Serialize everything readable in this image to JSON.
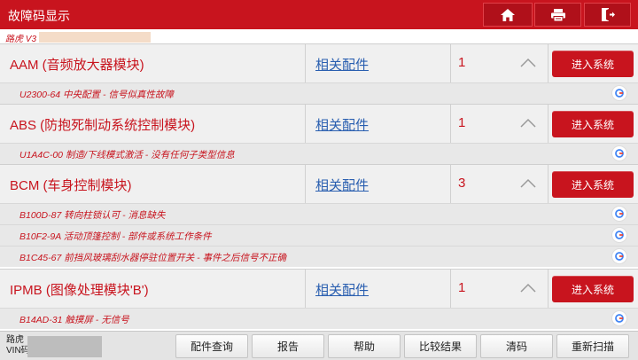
{
  "header": {
    "title": "故障码显示",
    "buttons": [
      "home-icon",
      "print-icon",
      "exit-icon"
    ]
  },
  "vehicle_label": "路虎 V3",
  "systems": [
    {
      "name": "AAM (音频放大器模块)",
      "parts_link": "相关配件",
      "count": "1",
      "enter": "进入系统",
      "dtcs": [
        "U2300-64 中央配置 - 信号似真性故障"
      ]
    },
    {
      "name": "ABS (防抱死制动系统控制模块)",
      "parts_link": "相关配件",
      "count": "1",
      "enter": "进入系统",
      "dtcs": [
        "U1A4C-00 制造/下线模式激活 - 没有任何子类型信息"
      ]
    },
    {
      "name": "BCM (车身控制模块)",
      "parts_link": "相关配件",
      "count": "3",
      "enter": "进入系统",
      "dtcs": [
        "B100D-87 转向柱锁认可 - 消息缺失",
        "B10F2-9A 活动顶篷控制 - 部件或系统工作条件",
        "B1C45-67 前挡风玻璃刮水器停驻位置开关 - 事件之后信号不正确"
      ]
    },
    {
      "name": "IPMB (图像处理模块'B')",
      "parts_link": "相关配件",
      "count": "1",
      "enter": "进入系统",
      "dtcs": [
        "B14AD-31 触摸屏 - 无信号"
      ]
    }
  ],
  "footer": {
    "info_line1": "路虎",
    "info_line2": "VIN码",
    "buttons": [
      "配件查询",
      "报告",
      "帮助",
      "比较结果",
      "清码",
      "重新扫描"
    ]
  },
  "colors": {
    "brand": "#c8141e",
    "link": "#2a5fb0"
  }
}
